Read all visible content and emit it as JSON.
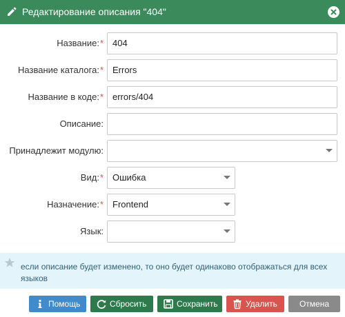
{
  "dialog": {
    "title": "Редактирование описания \"404\"",
    "accent_color": "#3b8a5c",
    "title_icon": "pencil-icon",
    "close_icon": "close-icon"
  },
  "fields": [
    {
      "label": "Название:",
      "required": "*",
      "value": "404",
      "kind": "text"
    },
    {
      "label": "Название каталога:",
      "required": "*",
      "value": "Errors",
      "kind": "text"
    },
    {
      "label": "Название в коде:",
      "required": "*",
      "value": "errors/404",
      "kind": "text"
    },
    {
      "label": "Описание:",
      "value": "",
      "kind": "text"
    },
    {
      "label": "Принадлежит модулю:",
      "value": "",
      "kind": "select"
    },
    {
      "label": "Вид:",
      "required": "*",
      "value": "Ошибка",
      "kind": "select"
    },
    {
      "label": "Назначение:",
      "required": "*",
      "value": "Frontend",
      "kind": "select"
    },
    {
      "label": "Язык:",
      "value": "",
      "kind": "select"
    }
  ],
  "notice": {
    "icon": "star-icon",
    "text": "если описание будет изменено, то оно будет одинаково отображаться для всех языков",
    "bg_color": "#e4f4fb"
  },
  "buttons": {
    "help": {
      "label": "Помощь",
      "icon": "info-icon",
      "color": "#428bca"
    },
    "reset": {
      "label": "Сбросить",
      "icon": "refresh-icon",
      "color": "#2d7a4c"
    },
    "save": {
      "label": "Сохранить",
      "icon": "save-icon",
      "color": "#2d7a4c"
    },
    "delete": {
      "label": "Удалить",
      "icon": "trash-icon",
      "color": "#d9534f"
    },
    "cancel": {
      "label": "Отмена",
      "color": "#8a8a8a"
    }
  }
}
